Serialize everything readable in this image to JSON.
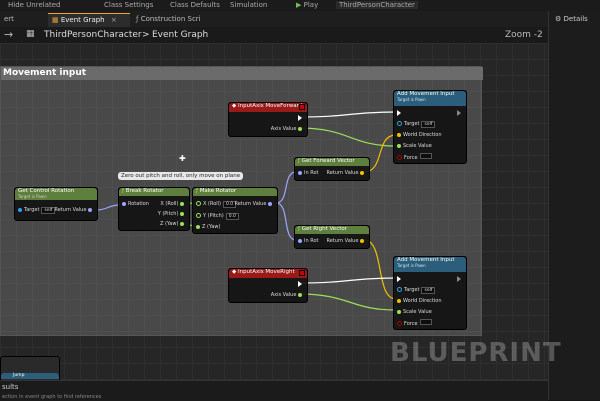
{
  "toolbar": {
    "hide_unrelated": "Hide Unrelated",
    "class_settings": "Class Settings",
    "class_defaults": "Class Defaults",
    "simulation": "Simulation",
    "play": "Play",
    "debug_object": "ThirdPersonCharacter"
  },
  "tabs": {
    "left_fragment": "ert",
    "event_graph": "Event Graph",
    "construction_script": "Construction Scri"
  },
  "right_panel": {
    "details": "Details"
  },
  "breadcrumb": {
    "root": "ThirdPersonCharacter",
    "separator": ">",
    "current": "Event Graph"
  },
  "zoom": "Zoom -2",
  "comment": {
    "title": "Movement input"
  },
  "reroute_comment": "Zero out pitch and roll, only move on plane",
  "nodes": {
    "get_control_rotation": {
      "title": "Get Control Rotation",
      "subtitle": "Target is Pawn",
      "target": "Target",
      "self": "self",
      "return": "Return Value"
    },
    "break_rotator": {
      "title": "Break Rotator",
      "rotation": "Rotation",
      "x": "X (Roll)",
      "y": "Y (Pitch)",
      "z": "Z (Yaw)"
    },
    "make_rotator": {
      "title": "Make Rotator",
      "x": "X (Roll)",
      "y": "Y (Pitch)",
      "z": "Z (Yaw)",
      "x_val": "0.0",
      "y_val": "0.0",
      "return": "Return Value"
    },
    "move_forward": {
      "title": "InputAxis MoveForward",
      "axis": "Axis Value"
    },
    "move_right": {
      "title": "InputAxis MoveRight",
      "axis": "Axis Value"
    },
    "get_forward": {
      "title": "Get Forward Vector",
      "inrot": "In Rot",
      "return": "Return Value"
    },
    "get_right": {
      "title": "Get Right Vector",
      "inrot": "In Rot",
      "return": "Return Value"
    },
    "add_movement_1": {
      "title": "Add Movement Input",
      "subtitle": "Target is Pawn",
      "target": "Target",
      "self": "self",
      "world_dir": "World Direction",
      "scale": "Scale Value",
      "force": "Force"
    },
    "add_movement_2": {
      "title": "Add Movement Input",
      "subtitle": "Target is Pawn",
      "target": "Target",
      "self": "self",
      "world_dir": "World Direction",
      "scale": "Scale Value",
      "force": "Force"
    }
  },
  "bottom": {
    "results": "sults",
    "mini_node": "Jump",
    "search_hint": "ection in event graph to find references"
  },
  "watermark": "BLUEPRINT",
  "colors": {
    "exec": "#ffffff",
    "vector": "#f0c000",
    "rotator": "#9aa6ff",
    "float": "#9ae05a",
    "object": "#2aa4e6",
    "bool": "#a00000",
    "input_event": "#9a1a1a",
    "pure_function": "#5f7f3f",
    "function": "#2b5e7a"
  }
}
